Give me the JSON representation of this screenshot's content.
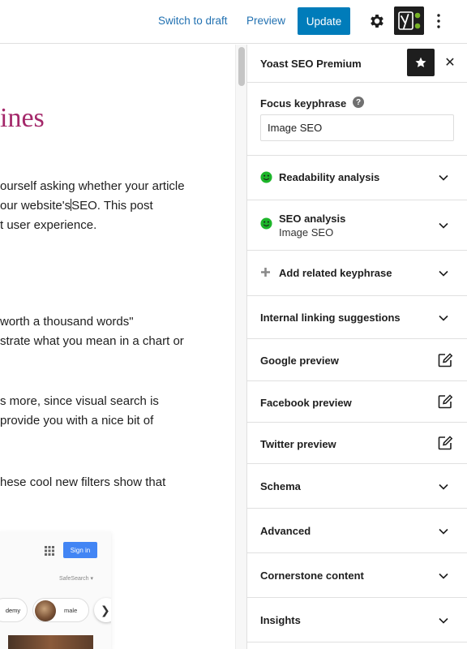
{
  "toolbar": {
    "switch_to_draft": "Switch to draft",
    "preview": "Preview",
    "update": "Update"
  },
  "editor": {
    "heading": "ines",
    "p1": [
      "ourself asking whether your article",
      "our website's",
      "SEO. This post",
      "t user experience."
    ],
    "p2": [
      " worth a thousand words\"",
      "strate what you mean in a chart or"
    ],
    "p3": [
      "s more, since visual search is",
      " provide you with a nice bit of"
    ],
    "p4": [
      "hese cool new filters show that"
    ],
    "google_image": {
      "sign_in": "Sign in",
      "safesearch": "SafeSearch ▾",
      "chip_left": "demy",
      "chip_right": "male",
      "next": "❯"
    }
  },
  "sidebar": {
    "title": "Yoast SEO Premium",
    "close": "✕",
    "focus_keyphrase": {
      "label": "Focus keyphrase",
      "help": "?",
      "value": "Image SEO"
    },
    "panels": [
      {
        "label": "Readability analysis",
        "icon": "smiley-good-icon",
        "type": "collapse"
      },
      {
        "label": "SEO analysis",
        "sub": "Image SEO",
        "icon": "smiley-good-icon",
        "type": "collapse"
      },
      {
        "label": "Add related keyphrase",
        "icon": "plus-icon",
        "type": "collapse"
      },
      {
        "label": "Internal linking suggestions",
        "type": "collapse"
      },
      {
        "label": "Google preview",
        "type": "edit"
      },
      {
        "label": "Facebook preview",
        "type": "edit"
      },
      {
        "label": "Twitter preview",
        "type": "edit"
      },
      {
        "label": "Schema",
        "type": "collapse"
      },
      {
        "label": "Advanced",
        "type": "collapse"
      },
      {
        "label": "Cornerstone content",
        "type": "collapse"
      },
      {
        "label": "Insights",
        "type": "collapse"
      }
    ]
  },
  "colors": {
    "accent": "#007cba",
    "link": "#2271b1",
    "heading": "#a4286a",
    "good": "#1db52a",
    "yoast_green": "#77b227"
  }
}
